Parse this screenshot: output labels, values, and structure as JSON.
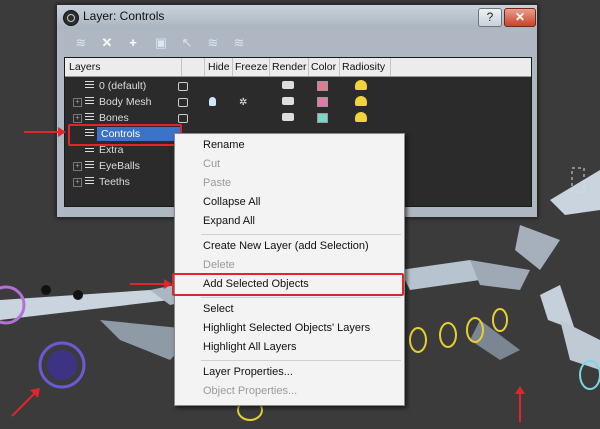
{
  "window": {
    "title": "Layer: Controls",
    "help_label": "?",
    "close_label": "✕"
  },
  "toolbar": {
    "icons": [
      "new-layer-icon",
      "delete-icon",
      "add-icon",
      "select-objects-icon",
      "highlight-icon",
      "hide-all-icon",
      "freeze-all-icon"
    ]
  },
  "columns": [
    "Layers",
    "Hide",
    "Freeze",
    "Render",
    "Color",
    "Radiosity"
  ],
  "layers": [
    {
      "name": "0 (default)",
      "expandable": false,
      "color": "#e07a8e"
    },
    {
      "name": "Body Mesh",
      "expandable": true,
      "color": "#e07aa8"
    },
    {
      "name": "Bones",
      "expandable": true,
      "color": "#7ad8c8"
    },
    {
      "name": "Controls",
      "expandable": false,
      "color": "#e6e04a",
      "selected": true
    },
    {
      "name": "Extra",
      "expandable": false
    },
    {
      "name": "EyeBalls",
      "expandable": true
    },
    {
      "name": "Teeths",
      "expandable": true
    }
  ],
  "context_menu": {
    "items": [
      {
        "label": "Rename",
        "enabled": true
      },
      {
        "label": "Cut",
        "enabled": false
      },
      {
        "label": "Paste",
        "enabled": false
      },
      {
        "label": "Collapse All",
        "enabled": true
      },
      {
        "label": "Expand All",
        "enabled": true
      },
      {
        "label": "Create New Layer (add Selection)",
        "enabled": true
      },
      {
        "label": "Delete",
        "enabled": false
      },
      {
        "label": "Add Selected Objects",
        "enabled": true,
        "highlighted": true
      },
      {
        "label": "Select",
        "enabled": true
      },
      {
        "label": "Highlight Selected Objects' Layers",
        "enabled": true
      },
      {
        "label": "Highlight All Layers",
        "enabled": true
      },
      {
        "label": "Layer Properties...",
        "enabled": true
      },
      {
        "label": "Object Properties...",
        "enabled": false
      }
    ]
  },
  "colors": {
    "annotation": "#e0262b",
    "selection": "#3b73c7",
    "viewport_bg": "#3b3b3b"
  }
}
